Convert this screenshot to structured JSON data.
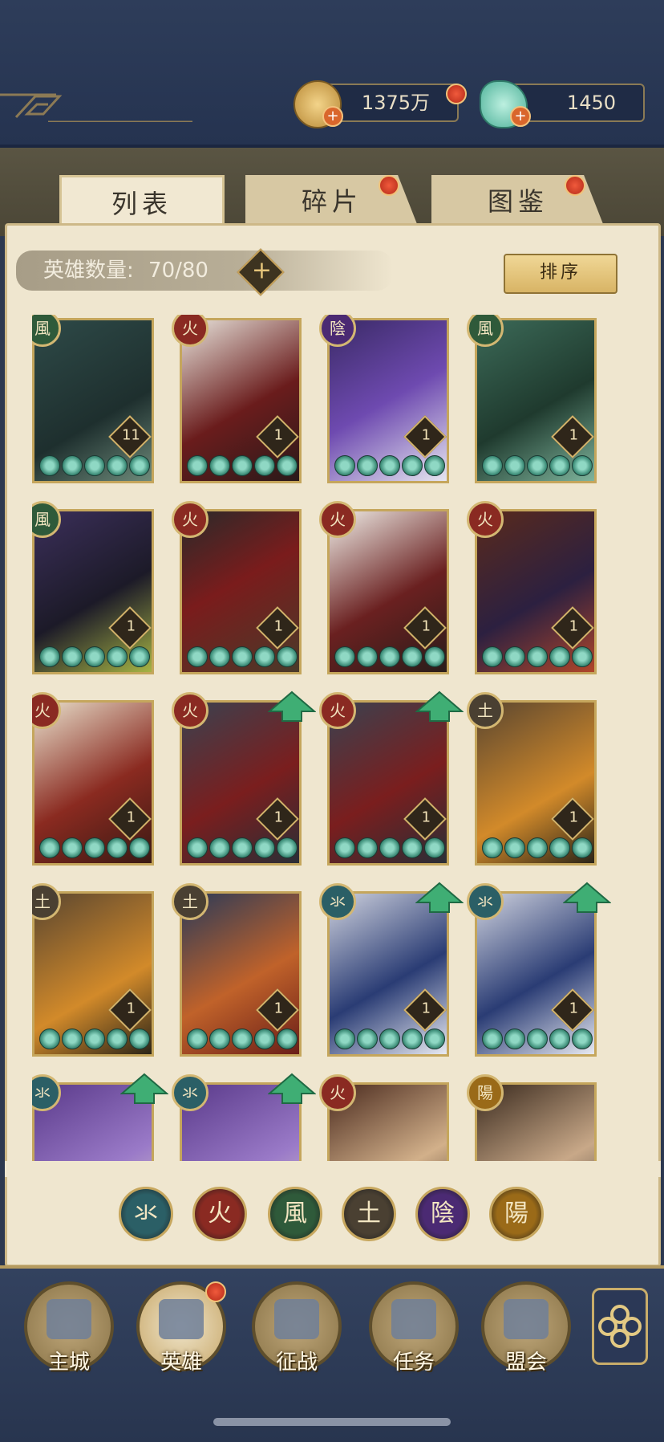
{
  "header": {
    "currency_coins": "1375万",
    "currency_jade": "1450"
  },
  "tabs": [
    {
      "label": "列表",
      "active": true,
      "has_dot": false
    },
    {
      "label": "碎片",
      "active": false,
      "has_dot": true
    },
    {
      "label": "图鉴",
      "active": false,
      "has_dot": true
    }
  ],
  "list": {
    "count_label": "英雄数量:",
    "count_value": "70/80",
    "sort_label": "排序"
  },
  "elements": {
    "water": "氺",
    "fire": "火",
    "wind": "風",
    "earth": "土",
    "yin": "陰",
    "yang": "陽"
  },
  "element_colors": {
    "water": "#2b5f66",
    "fire": "#8a2a22",
    "wind": "#2f5a3a",
    "earth": "#4a4032",
    "yin": "#4b2a73",
    "yang": "#9a6a18"
  },
  "heroes": [
    {
      "element": "wind",
      "level": "11",
      "upgrade": false
    },
    {
      "element": "fire",
      "level": "1",
      "upgrade": false
    },
    {
      "element": "yin",
      "level": "1",
      "upgrade": false
    },
    {
      "element": "wind",
      "level": "1",
      "upgrade": false
    },
    {
      "element": "wind",
      "level": "1",
      "upgrade": false
    },
    {
      "element": "fire",
      "level": "1",
      "upgrade": false
    },
    {
      "element": "fire",
      "level": "1",
      "upgrade": false
    },
    {
      "element": "fire",
      "level": "1",
      "upgrade": false
    },
    {
      "element": "fire",
      "level": "1",
      "upgrade": false
    },
    {
      "element": "fire",
      "level": "1",
      "upgrade": true
    },
    {
      "element": "fire",
      "level": "1",
      "upgrade": true
    },
    {
      "element": "earth",
      "level": "1",
      "upgrade": false
    },
    {
      "element": "earth",
      "level": "1",
      "upgrade": false
    },
    {
      "element": "earth",
      "level": "1",
      "upgrade": false
    },
    {
      "element": "water",
      "level": "1",
      "upgrade": true
    },
    {
      "element": "water",
      "level": "1",
      "upgrade": true
    },
    {
      "element": "water",
      "level": "",
      "upgrade": true
    },
    {
      "element": "water",
      "level": "",
      "upgrade": true
    },
    {
      "element": "fire",
      "level": "",
      "upgrade": false
    },
    {
      "element": "yang",
      "level": "",
      "upgrade": false
    }
  ],
  "filters": [
    "water",
    "fire",
    "wind",
    "earth",
    "yin",
    "yang"
  ],
  "bottom_nav": [
    {
      "label": "主城",
      "id": "main-city"
    },
    {
      "label": "英雄",
      "id": "heroes",
      "has_dot": true
    },
    {
      "label": "征战",
      "id": "campaign"
    },
    {
      "label": "任务",
      "id": "tasks"
    },
    {
      "label": "盟会",
      "id": "guild"
    }
  ]
}
